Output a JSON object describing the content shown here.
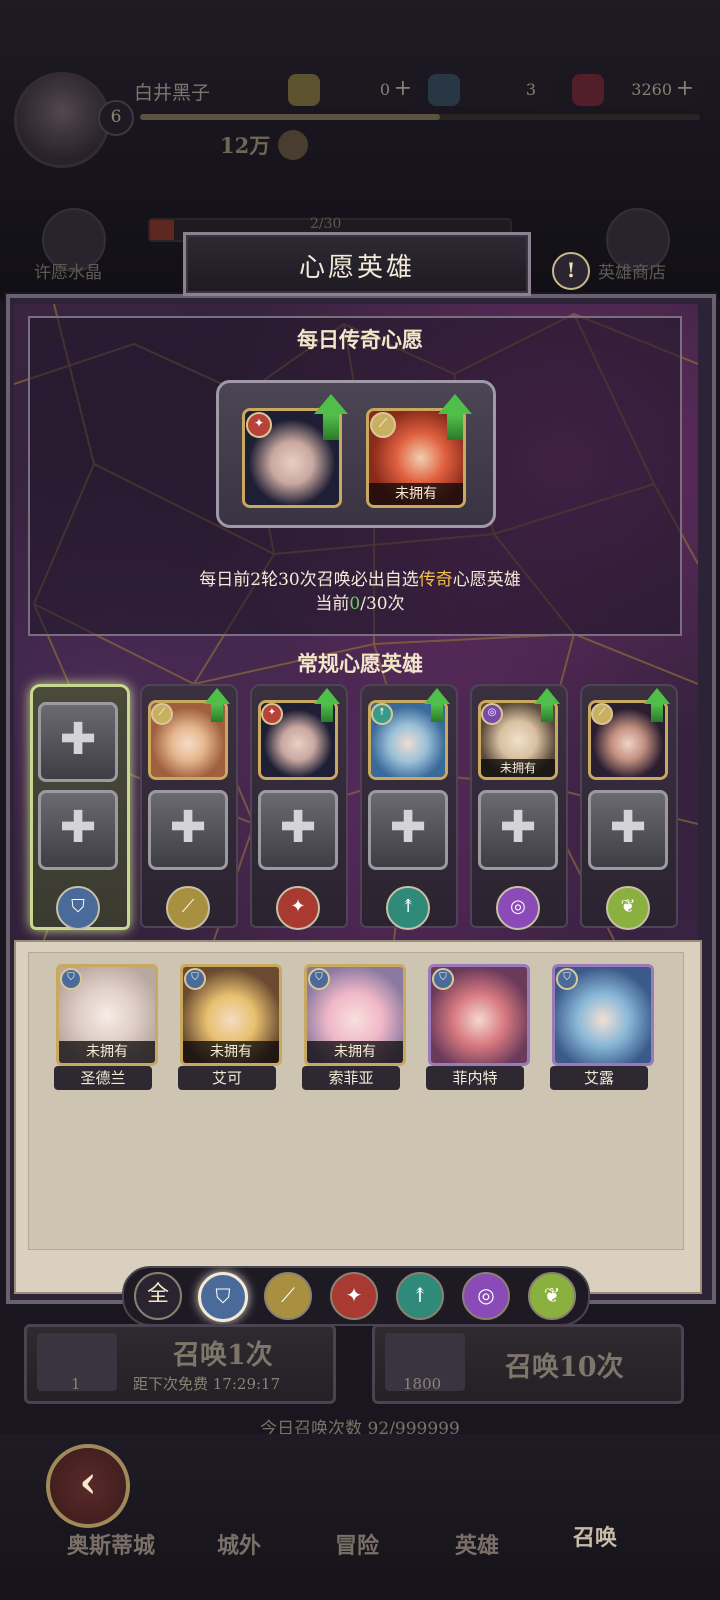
{
  "player": {
    "name": "白井黑子",
    "level": "6",
    "power": "12万"
  },
  "resources": [
    {
      "icon": "coin-icon",
      "value": "0"
    },
    {
      "icon": "scroll-icon",
      "value": "3"
    },
    {
      "icon": "gem-icon",
      "value": "3260"
    }
  ],
  "side": {
    "left_label": "许愿水晶",
    "right_label": "英雄商店",
    "progress_text": "2/30"
  },
  "panel": {
    "title": "心愿英雄",
    "info_symbol": "!",
    "daily_title": "每日传奇心愿",
    "daily_unowned": "未拥有",
    "daily_desc_prefix": "每日前2轮30次召唤必出自选",
    "daily_desc_highlight": "传奇",
    "daily_desc_suffix": "心愿英雄",
    "daily_current_prefix": "当前",
    "daily_current_value": "0",
    "daily_current_suffix": "/30次",
    "regular_title": "常规心愿英雄",
    "plus_symbol": "✚",
    "regular_unowned": "未拥有"
  },
  "hero_list": [
    {
      "name": "圣德兰",
      "status": "未拥有"
    },
    {
      "name": "艾可",
      "status": "未拥有"
    },
    {
      "name": "索菲亚",
      "status": "未拥有"
    },
    {
      "name": "菲内特",
      "status": ""
    },
    {
      "name": "艾露",
      "status": ""
    }
  ],
  "filters": {
    "all_label": "全",
    "items": [
      "shield-icon",
      "sword-icon",
      "flame-icon",
      "arrows-icon",
      "magic-icon",
      "leaf-icon"
    ]
  },
  "summon": {
    "single_label": "召唤1次",
    "single_cost": "1",
    "single_sub": "距下次免费 17:29:17",
    "ten_label": "召唤10次",
    "ten_cost": "1800"
  },
  "daily_summon_count": "今日召唤次数 92/999999",
  "nav": {
    "items": [
      "奥斯蒂城",
      "城外",
      "冒险",
      "英雄",
      "召唤"
    ],
    "current": "召唤"
  },
  "colors": {
    "accent_gold": "#f1c24a",
    "accent_green": "#6ed06a",
    "panel_purple": "#2d2336"
  }
}
